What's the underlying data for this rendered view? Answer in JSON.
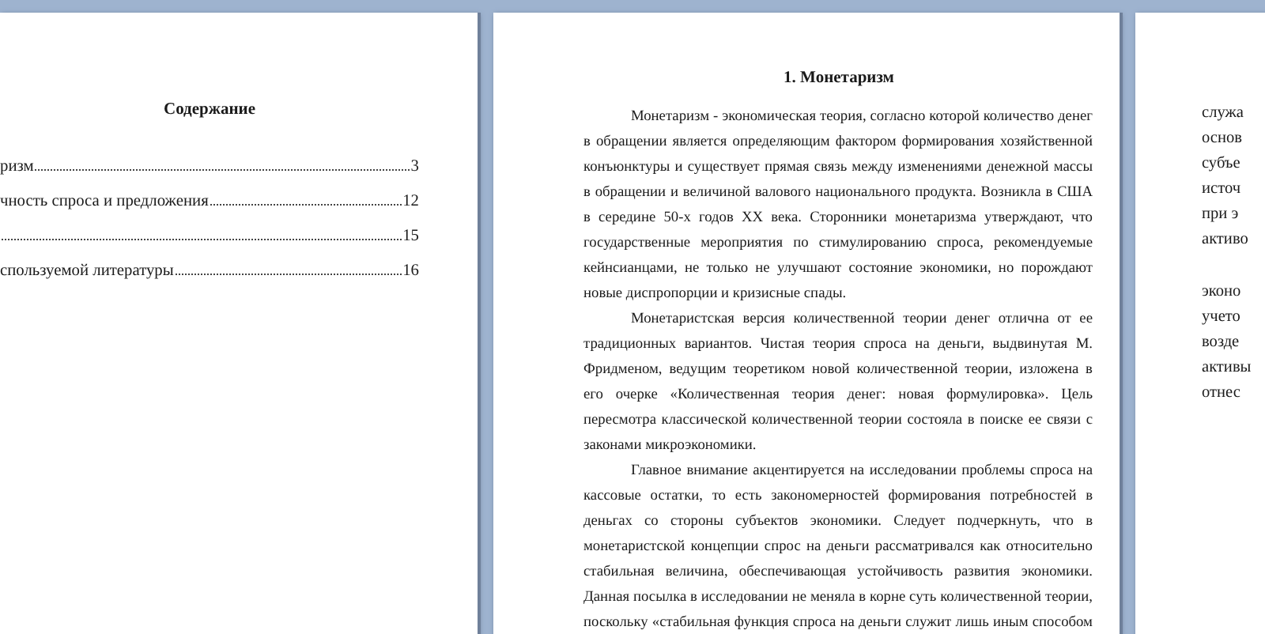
{
  "left_page": {
    "title": "Содержание",
    "toc": [
      {
        "text": "ризм",
        "page": "3"
      },
      {
        "text": "чность спроса и предложения",
        "page": "12"
      },
      {
        "page": "15"
      },
      {
        "text": "спользуемой литературы",
        "page": "16"
      }
    ]
  },
  "middle_page": {
    "heading": "1. Монетаризм",
    "paragraphs": [
      [
        "Монетаризм - экономическая теория, согласно которой количество денег",
        "в обращении является определяющим фактором формирования хозяйственной",
        "конъюнктуры и существует прямая связь между изменениями денежной массы",
        "в обращении и величиной валового национального продукта. Возникла в США",
        "в середине 50-х годов XX века. Сторонники монетаризма утверждают, что",
        "государственные мероприятия по стимулированию спроса, рекомендуемые",
        "кейнсианцами, не только не улучшают состояние экономики, но порождают",
        "новые диспропорции и кризисные спады."
      ],
      [
        "Монетаристская версия количественной теории денег отлична от ее",
        "традиционных вариантов. Чистая теория спроса на деньги, выдвинутая М.",
        "Фридменом, ведущим теоретиком новой количественной теории, изложена в",
        "его очерке «Количественная теория денег: новая формулировка». Цель",
        "пересмотра классической количественной теории состояла в поиске ее связи с",
        "законами микроэкономики."
      ],
      [
        "Главное внимание акцентируется на исследовании проблемы спроса на",
        "кассовые остатки, то есть закономерностей формирования потребностей в",
        "деньгах со стороны субъектов экономики. Следует подчеркнуть, что в",
        "монетаристской концепции спрос на деньги рассматривался как относительно",
        "стабильная величина, обеспечивающая устойчивость развития экономики.",
        "Данная посылка в исследовании не меняла в корне суть количественной теории,",
        "поскольку «стабильная функция спроса на деньги служит лишь иным способом"
      ]
    ]
  },
  "right_page": {
    "paragraphs": [
      [
        "служа",
        "основ",
        "субъе",
        "источ",
        "при э",
        "активо"
      ],
      [
        "эконо",
        "учето",
        "возде",
        "активы",
        "отнес"
      ]
    ]
  }
}
